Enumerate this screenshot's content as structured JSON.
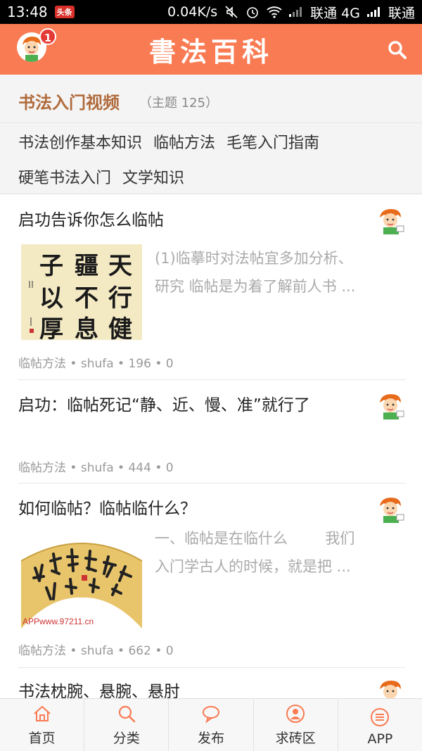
{
  "status_bar": {
    "time": "13:48",
    "app_badge": "头条",
    "speed": "0.04K/s",
    "carrier1": "联通 4G",
    "carrier2": "联通"
  },
  "header": {
    "title": "書法百科",
    "notification_count": "1",
    "colors": {
      "header_bg": "#f97b53"
    }
  },
  "category": {
    "title": "书法入门视频",
    "count": "（主题 125）",
    "tags": [
      "书法创作基本知识",
      "临帖方法",
      "毛笔入门指南",
      "硬笔书法入门",
      "文学知识"
    ]
  },
  "feed": {
    "items": [
      {
        "title": "启功告诉你怎么临帖",
        "excerpt_line1": "(1)临摹时对法帖宜多加分析、",
        "excerpt_line2": "研究 临帖是为着了解前人书 ...",
        "meta": "临帖方法 • shufa • 196 • 0",
        "image_chars": [
          "天",
          "疆",
          "子",
          "行",
          "不",
          "以",
          "健",
          "息",
          "厚"
        ]
      },
      {
        "title": "启功：临帖死记“静、近、慢、准”就行了",
        "meta": "临帖方法 • shufa • 444 • 0"
      },
      {
        "title": "如何临帖？临帖临什么？",
        "excerpt_line1": "一、临帖是在临什么        我们",
        "excerpt_line2": "入门学古人的时候，就是把 ...",
        "meta": "临帖方法 • shufa • 662 • 0",
        "image_caption": "APPwww.97211.cn"
      },
      {
        "title": "书法枕腕、悬腕、悬肘"
      }
    ]
  },
  "tabbar": {
    "tabs": [
      "首页",
      "分类",
      "发布",
      "求砖区",
      "APP"
    ]
  }
}
